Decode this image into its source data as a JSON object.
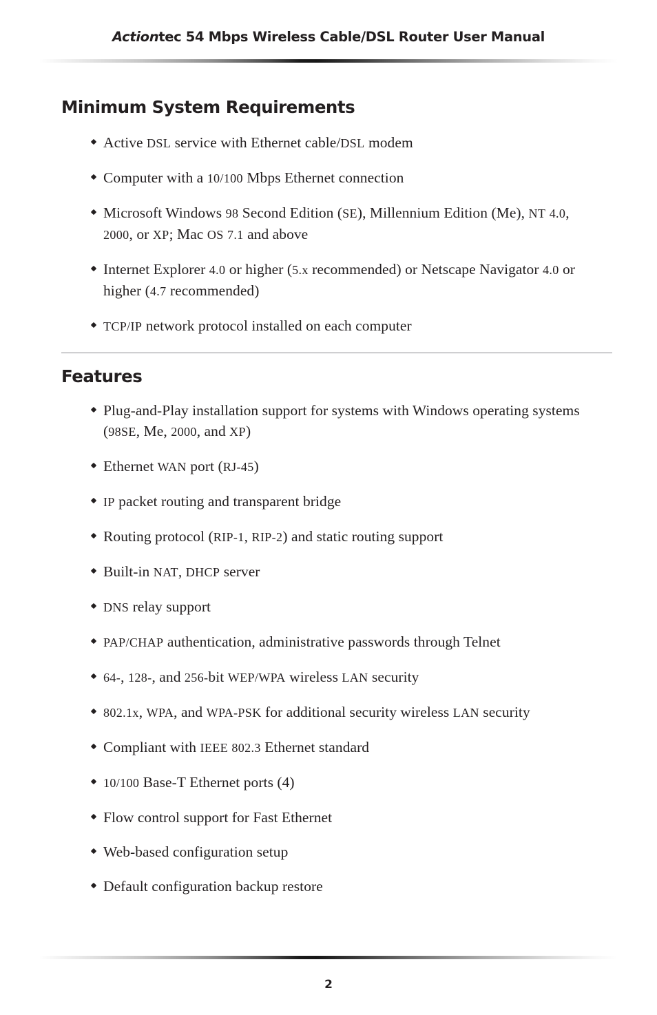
{
  "document": {
    "header_title_brand": "Action",
    "header_title_rest": "tec 54 Mbps Wireless Cable/DSL Router User Manual",
    "page_number": "2"
  },
  "sections": [
    {
      "heading": "Minimum System Requirements",
      "bullets": [
        "Active DSL service with Ethernet cable/DSL modem",
        "Computer with a 10/100 Mbps Ethernet connection",
        "Microsoft Windows 98 Second Edition (SE), Millennium Edition (Me), NT 4.0, 2000, or XP; Mac OS 7.1 and above",
        "Internet Explorer 4.0 or higher (5.x recommended) or Netscape Navigator 4.0 or higher (4.7 recommended)",
        "TCP/IP network protocol installed on each computer"
      ]
    },
    {
      "heading": "Features",
      "bullets": [
        "Plug-and-Play installation support for systems with Windows operating systems (98SE, Me, 2000, and XP)",
        "Ethernet WAN port (RJ-45)",
        "IP packet routing and transparent bridge",
        "Routing protocol (RIP-1, RIP-2) and static routing support",
        "Built-in NAT, DHCP server",
        "DNS relay support",
        "PAP/CHAP authentication, administrative passwords through Telnet",
        "64-, 128-, and 256-bit WEP/WPA wireless LAN security",
        "802.1x, WPA, and WPA-PSK for additional security wireless LAN security",
        "Compliant with IEEE 802.3 Ethernet standard",
        "10/100 Base-T Ethernet ports (4)",
        "Flow control support for Fast Ethernet",
        "Web-based configuration setup",
        "Default configuration backup restore"
      ]
    }
  ],
  "colors": {
    "text": "#231f20",
    "rule": "#8a8a8e",
    "background": "#ffffff"
  }
}
